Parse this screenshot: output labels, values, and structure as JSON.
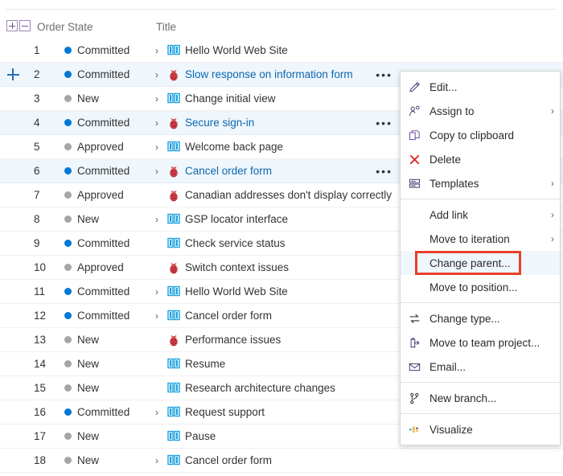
{
  "grid": {
    "header": {
      "expand_all_label": "+",
      "collapse_all_label": "−",
      "columns": [
        "Order",
        "State",
        "Title"
      ]
    },
    "expand_row_button": "+",
    "ellipsis_label": "•••",
    "chevron": "›",
    "colors": {
      "committed_dot": "#0078d4",
      "inactive_dot": "#a6a6a6",
      "link": "#0a67b1",
      "selected_row": "#eff6fc",
      "bug_icon": "#e03a44",
      "feature_icon": "#0f9bd7"
    },
    "rows": [
      {
        "order": "1",
        "state": "Committed",
        "state_kind": "active",
        "expandable": true,
        "icon": "feature-icon",
        "title": "Hello World Web Site",
        "link": false,
        "selected": false,
        "show_ellipsis": false,
        "show_plus": false
      },
      {
        "order": "2",
        "state": "Committed",
        "state_kind": "active",
        "expandable": true,
        "icon": "bug-icon",
        "title": "Slow response on information form",
        "link": true,
        "selected": true,
        "show_ellipsis": true,
        "show_plus": true
      },
      {
        "order": "3",
        "state": "New",
        "state_kind": "inactive",
        "expandable": true,
        "icon": "feature-icon",
        "title": "Change initial view",
        "link": false,
        "selected": false,
        "show_ellipsis": false,
        "show_plus": false
      },
      {
        "order": "4",
        "state": "Committed",
        "state_kind": "active",
        "expandable": true,
        "icon": "bug-icon",
        "title": "Secure sign-in",
        "link": true,
        "selected": true,
        "show_ellipsis": true,
        "show_plus": false
      },
      {
        "order": "5",
        "state": "Approved",
        "state_kind": "inactive",
        "expandable": true,
        "icon": "feature-icon",
        "title": "Welcome back page",
        "link": false,
        "selected": false,
        "show_ellipsis": false,
        "show_plus": false
      },
      {
        "order": "6",
        "state": "Committed",
        "state_kind": "active",
        "expandable": true,
        "icon": "bug-icon",
        "title": "Cancel order form",
        "link": true,
        "selected": true,
        "show_ellipsis": true,
        "show_plus": false
      },
      {
        "order": "7",
        "state": "Approved",
        "state_kind": "inactive",
        "expandable": false,
        "icon": "bug-icon",
        "title": "Canadian addresses don't display correctly",
        "link": false,
        "selected": false,
        "show_ellipsis": false,
        "show_plus": false
      },
      {
        "order": "8",
        "state": "New",
        "state_kind": "inactive",
        "expandable": true,
        "icon": "feature-icon",
        "title": "GSP locator interface",
        "link": false,
        "selected": false,
        "show_ellipsis": false,
        "show_plus": false
      },
      {
        "order": "9",
        "state": "Committed",
        "state_kind": "active",
        "expandable": false,
        "icon": "feature-icon",
        "title": "Check service status",
        "link": false,
        "selected": false,
        "show_ellipsis": false,
        "show_plus": false
      },
      {
        "order": "10",
        "state": "Approved",
        "state_kind": "inactive",
        "expandable": false,
        "icon": "bug-icon",
        "title": "Switch context issues",
        "link": false,
        "selected": false,
        "show_ellipsis": false,
        "show_plus": false
      },
      {
        "order": "11",
        "state": "Committed",
        "state_kind": "active",
        "expandable": true,
        "icon": "feature-icon",
        "title": "Hello World Web Site",
        "link": false,
        "selected": false,
        "show_ellipsis": false,
        "show_plus": false
      },
      {
        "order": "12",
        "state": "Committed",
        "state_kind": "active",
        "expandable": true,
        "icon": "feature-icon",
        "title": "Cancel order form",
        "link": false,
        "selected": false,
        "show_ellipsis": false,
        "show_plus": false
      },
      {
        "order": "13",
        "state": "New",
        "state_kind": "inactive",
        "expandable": false,
        "icon": "bug-icon",
        "title": "Performance issues",
        "link": false,
        "selected": false,
        "show_ellipsis": false,
        "show_plus": false
      },
      {
        "order": "14",
        "state": "New",
        "state_kind": "inactive",
        "expandable": false,
        "icon": "feature-icon",
        "title": "Resume",
        "link": false,
        "selected": false,
        "show_ellipsis": false,
        "show_plus": false
      },
      {
        "order": "15",
        "state": "New",
        "state_kind": "inactive",
        "expandable": false,
        "icon": "feature-icon",
        "title": "Research architecture changes",
        "link": false,
        "selected": false,
        "show_ellipsis": false,
        "show_plus": false
      },
      {
        "order": "16",
        "state": "Committed",
        "state_kind": "active",
        "expandable": true,
        "icon": "feature-icon",
        "title": "Request support",
        "link": false,
        "selected": false,
        "show_ellipsis": false,
        "show_plus": false
      },
      {
        "order": "17",
        "state": "New",
        "state_kind": "inactive",
        "expandable": false,
        "icon": "feature-icon",
        "title": "Pause",
        "link": false,
        "selected": false,
        "show_ellipsis": false,
        "show_plus": false
      },
      {
        "order": "18",
        "state": "New",
        "state_kind": "inactive",
        "expandable": true,
        "icon": "feature-icon",
        "title": "Cancel order form",
        "link": false,
        "selected": false,
        "show_ellipsis": false,
        "show_plus": false
      }
    ]
  },
  "context_menu": {
    "submenu_arrow": "›",
    "highlight_color": "#e8402a",
    "items": [
      {
        "id": "edit",
        "label": "Edit...",
        "icon": "pencil-icon",
        "submenu": false,
        "group": 1,
        "highlighted": false,
        "hovered": false
      },
      {
        "id": "assign-to",
        "label": "Assign to",
        "icon": "person-icon",
        "submenu": true,
        "group": 1,
        "highlighted": false,
        "hovered": false
      },
      {
        "id": "copy-to-clipboard",
        "label": "Copy to clipboard",
        "icon": "copy-icon",
        "submenu": false,
        "group": 1,
        "highlighted": false,
        "hovered": false
      },
      {
        "id": "delete",
        "label": "Delete",
        "icon": "close-x-icon",
        "submenu": false,
        "group": 1,
        "highlighted": false,
        "hovered": false
      },
      {
        "id": "templates",
        "label": "Templates",
        "icon": "templates-icon",
        "submenu": true,
        "group": 1,
        "highlighted": false,
        "hovered": false
      },
      {
        "id": "add-link",
        "label": "Add link",
        "icon": "none",
        "submenu": true,
        "group": 2,
        "highlighted": false,
        "hovered": false
      },
      {
        "id": "move-to-iteration",
        "label": "Move to iteration",
        "icon": "none",
        "submenu": true,
        "group": 2,
        "highlighted": false,
        "hovered": false
      },
      {
        "id": "change-parent",
        "label": "Change parent...",
        "icon": "none",
        "submenu": false,
        "group": 2,
        "highlighted": true,
        "hovered": true
      },
      {
        "id": "move-to-position",
        "label": "Move to position...",
        "icon": "none",
        "submenu": false,
        "group": 2,
        "highlighted": false,
        "hovered": false
      },
      {
        "id": "change-type",
        "label": "Change type...",
        "icon": "swap-icon",
        "submenu": false,
        "group": 3,
        "highlighted": false,
        "hovered": false
      },
      {
        "id": "move-to-team-project",
        "label": "Move to team project...",
        "icon": "move-out-icon",
        "submenu": false,
        "group": 3,
        "highlighted": false,
        "hovered": false
      },
      {
        "id": "email",
        "label": "Email...",
        "icon": "envelope-icon",
        "submenu": false,
        "group": 3,
        "highlighted": false,
        "hovered": false
      },
      {
        "id": "new-branch",
        "label": "New branch...",
        "icon": "branch-icon",
        "submenu": false,
        "group": 4,
        "highlighted": false,
        "hovered": false
      },
      {
        "id": "visualize",
        "label": "Visualize",
        "icon": "visualize-icon",
        "submenu": false,
        "group": 5,
        "highlighted": false,
        "hovered": false
      }
    ]
  }
}
